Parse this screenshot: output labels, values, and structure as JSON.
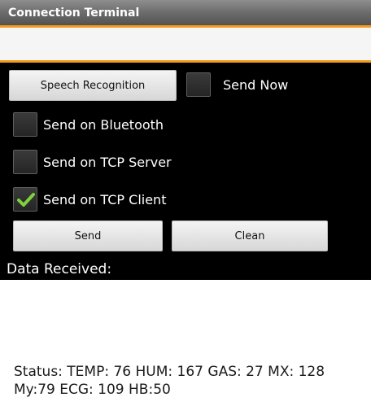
{
  "app": {
    "title": "Connection Terminal"
  },
  "input": {
    "value": ""
  },
  "buttons": {
    "speech": "Speech Recognition",
    "send": "Send",
    "clean": "Clean"
  },
  "checkboxes": {
    "send_now": {
      "label": "Send Now",
      "checked": false
    },
    "bluetooth": {
      "label": "Send on Bluetooth",
      "checked": false
    },
    "tcp_server": {
      "label": "Send on TCP Server",
      "checked": false
    },
    "tcp_client": {
      "label": "Send on TCP Client",
      "checked": true
    }
  },
  "data_received": {
    "label": "Data Received:"
  },
  "status": {
    "text": "Status: TEMP: 76 HUM: 167 GAS: 27 MX: 128 My:79 ECG: 109 HB:50"
  },
  "colors": {
    "accent": "#f39a1e",
    "check": "#7fd13b"
  }
}
